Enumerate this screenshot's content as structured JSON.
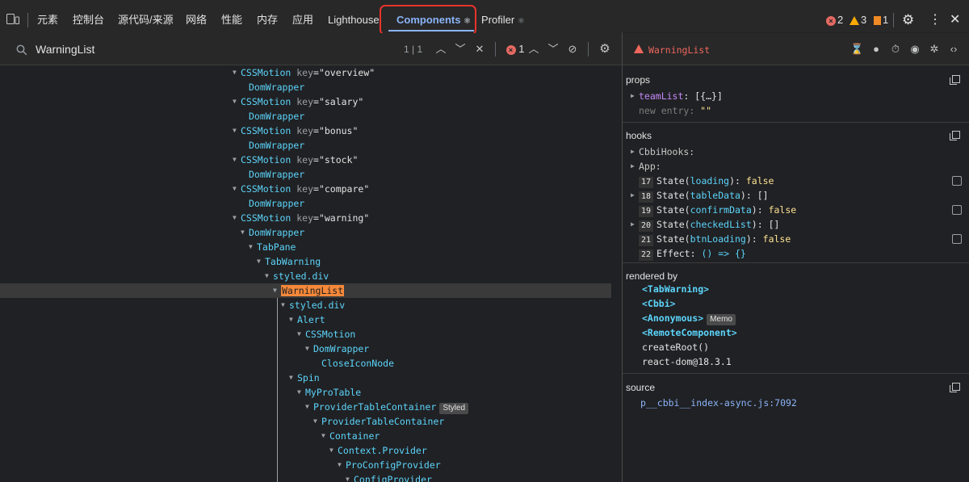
{
  "tabbar": {
    "tabs": [
      {
        "label": "元素"
      },
      {
        "label": "控制台"
      },
      {
        "label": "源代码/来源"
      },
      {
        "label": "网络"
      },
      {
        "label": "性能"
      },
      {
        "label": "内存"
      },
      {
        "label": "应用"
      },
      {
        "label": "Lighthouse"
      },
      {
        "label": "Components",
        "suffix": "⚛",
        "active": true
      },
      {
        "label": "Profiler",
        "suffix": "⚛"
      }
    ],
    "errors": "2",
    "warnings": "3",
    "issues": "1"
  },
  "search": {
    "value": "WarningList",
    "count": "1 | 1",
    "error_count": "1"
  },
  "tree": [
    {
      "name": "CSSMotion",
      "key": "overview"
    },
    {
      "name": "DomWrapper"
    },
    {
      "name": "CSSMotion",
      "key": "salary"
    },
    {
      "name": "DomWrapper"
    },
    {
      "name": "CSSMotion",
      "key": "bonus"
    },
    {
      "name": "DomWrapper"
    },
    {
      "name": "CSSMotion",
      "key": "stock"
    },
    {
      "name": "DomWrapper"
    },
    {
      "name": "CSSMotion",
      "key": "compare"
    },
    {
      "name": "DomWrapper"
    },
    {
      "name": "CSSMotion",
      "key": "warning"
    },
    {
      "name": "DomWrapper"
    },
    {
      "name": "TabPane"
    },
    {
      "name": "TabWarning"
    },
    {
      "name": "styled.div"
    },
    {
      "name": "WarningList",
      "selected": true
    },
    {
      "name": "styled.div"
    },
    {
      "name": "Alert"
    },
    {
      "name": "CSSMotion"
    },
    {
      "name": "DomWrapper"
    },
    {
      "name": "CloseIconNode"
    },
    {
      "name": "Spin"
    },
    {
      "name": "MyProTable"
    },
    {
      "name": "ProviderTableContainer",
      "badge": "Styled"
    },
    {
      "name": "ProviderTableContainer"
    },
    {
      "name": "Container"
    },
    {
      "name": "Context.Provider"
    },
    {
      "name": "ProConfigProvider"
    },
    {
      "name": "ConfigProvider"
    }
  ],
  "inspector": {
    "title": "WarningList",
    "props": {
      "label": "props",
      "team_key": "teamList",
      "team_val": "[{…}]",
      "new_entry_key": "new entry",
      "new_entry_val": "\"\""
    },
    "hooks": {
      "label": "hooks",
      "rows": [
        {
          "text": "CbbiHooks:"
        },
        {
          "text": "App:"
        },
        {
          "num": "17",
          "name": "State",
          "arg": "loading",
          "value": "false"
        },
        {
          "num": "18",
          "name": "State",
          "arg": "tableData",
          "value": "[]"
        },
        {
          "num": "19",
          "name": "State",
          "arg": "confirmData",
          "value": "false"
        },
        {
          "num": "20",
          "name": "State",
          "arg": "checkedList",
          "value": "[]"
        },
        {
          "num": "21",
          "name": "State",
          "arg": "btnLoading",
          "value": "false"
        },
        {
          "num": "22",
          "name": "Effect",
          "value": "() => {}"
        }
      ]
    },
    "rendered_by": {
      "label": "rendered by",
      "items": [
        {
          "text": "<TabWarning>"
        },
        {
          "text": "<Cbbi>"
        },
        {
          "text": "<Anonymous>",
          "badge": "Memo"
        },
        {
          "text": "<RemoteComponent>"
        },
        {
          "text": "createRoot()",
          "plain": true
        },
        {
          "text": "react-dom@18.3.1",
          "plain": true
        }
      ]
    },
    "source": {
      "label": "source",
      "value": "p__cbbi__index-async.js:7092"
    }
  }
}
